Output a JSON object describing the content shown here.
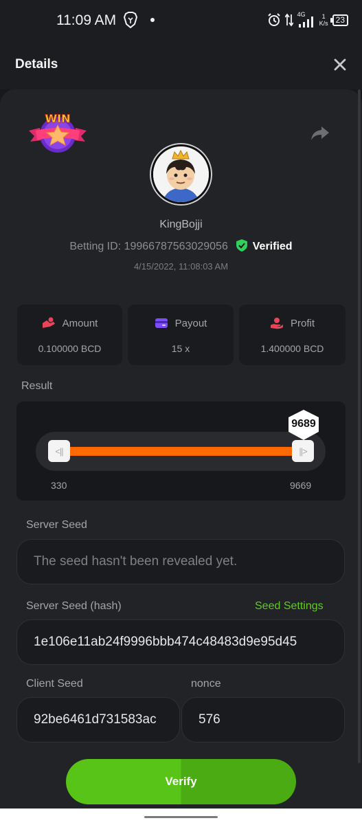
{
  "status_bar": {
    "time": "11:09 AM",
    "network": "4G",
    "speed_value": "1",
    "speed_unit": "K/s",
    "battery": "23"
  },
  "header": {
    "title": "Details"
  },
  "bet": {
    "badge": "WIN",
    "username": "KingBojji",
    "betting_id_label": "Betting ID:",
    "betting_id": "19966787563029056",
    "verified_label": "Verified",
    "timestamp": "4/15/2022, 11:08:03 AM"
  },
  "stats": [
    {
      "label": "Amount",
      "value": "0.100000 BCD",
      "icon": "amount-icon",
      "color": "#e8455a"
    },
    {
      "label": "Payout",
      "value": "15 x",
      "icon": "payout-icon",
      "color": "#7b4dff"
    },
    {
      "label": "Profit",
      "value": "1.400000 BCD",
      "icon": "profit-icon",
      "color": "#e8455a"
    }
  ],
  "result": {
    "label": "Result",
    "value": "9689",
    "range_min": "330",
    "range_max": "9669",
    "fill_color": "#ff6a00"
  },
  "server_seed": {
    "label": "Server Seed",
    "value": "The seed hasn't been revealed yet."
  },
  "server_seed_hash": {
    "label": "Server Seed (hash)",
    "link": "Seed Settings",
    "value": "1e106e11ab24f9996bbb474c48483d9e95d45"
  },
  "client_seed": {
    "label": "Client Seed",
    "value": "92be6461d731583ac"
  },
  "nonce": {
    "label": "nonce",
    "value": "576"
  },
  "verify_button": "Verify",
  "colors": {
    "accent_green": "#5fcc1f",
    "verified_green": "#2fd15a"
  }
}
